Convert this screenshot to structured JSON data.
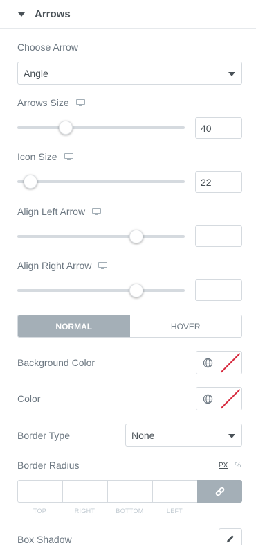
{
  "section": {
    "title": "Arrows"
  },
  "choose_arrow": {
    "label": "Choose Arrow",
    "value": "Angle"
  },
  "arrows_size": {
    "label": "Arrows Size",
    "value": "40",
    "slider_fraction": 0.29
  },
  "icon_size": {
    "label": "Icon Size",
    "value": "22",
    "slider_fraction": 0.08
  },
  "align_left_arrow": {
    "label": "Align Left Arrow",
    "value": "",
    "slider_fraction": 0.71
  },
  "align_right_arrow": {
    "label": "Align Right Arrow",
    "value": "",
    "slider_fraction": 0.71
  },
  "tabs": {
    "normal": "NORMAL",
    "hover": "HOVER",
    "active": "normal"
  },
  "background_color": {
    "label": "Background Color"
  },
  "color": {
    "label": "Color"
  },
  "border_type": {
    "label": "Border Type",
    "value": "None"
  },
  "border_radius": {
    "label": "Border Radius",
    "units": [
      "PX",
      "%"
    ],
    "active_unit": "PX",
    "dimensions": [
      "TOP",
      "RIGHT",
      "BOTTOM",
      "LEFT"
    ]
  },
  "box_shadow": {
    "label": "Box Shadow"
  },
  "icons": {
    "section_toggle": "caret-down-icon",
    "responsive": "desktop-monitor-icon",
    "global_colors": "globe-icon",
    "clear_color": "no-color-swatch",
    "link_values": "link-icon",
    "edit": "pencil-icon"
  },
  "colors": {
    "tab_active": "#a4afb7",
    "border": "#d5dadf",
    "text": "#6d7882",
    "swatch_slash": "#d72b3f"
  }
}
